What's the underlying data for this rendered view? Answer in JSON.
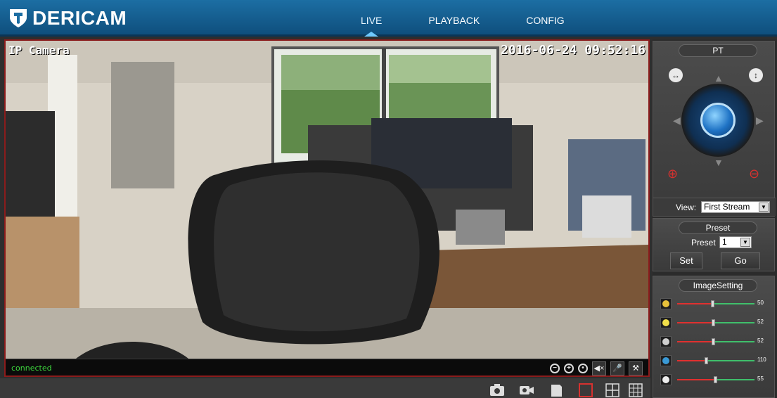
{
  "header": {
    "logo_text": "DERICAM",
    "nav": [
      {
        "label": "LIVE",
        "active": true
      },
      {
        "label": "PLAYBACK",
        "active": false
      },
      {
        "label": "CONFIG",
        "active": false
      }
    ]
  },
  "video": {
    "osd_name": "IP Camera",
    "osd_datetime": "2016-06-24 09:52:16",
    "status": "connected"
  },
  "ptz": {
    "title": "PT",
    "view_label": "View:",
    "view_value": "First Stream"
  },
  "preset": {
    "title": "Preset",
    "label": "Preset",
    "value": "1",
    "set_label": "Set",
    "go_label": "Go"
  },
  "image_setting": {
    "title": "ImageSetting",
    "sliders": [
      {
        "icon": "color-icon",
        "value": "50",
        "level": 0.45
      },
      {
        "icon": "brightness-icon",
        "value": "52",
        "level": 0.46
      },
      {
        "icon": "contrast-icon",
        "value": "52",
        "level": 0.46
      },
      {
        "icon": "saturation-icon",
        "value": "110",
        "level": 0.37
      },
      {
        "icon": "sharpness-icon",
        "value": "55",
        "level": 0.49
      }
    ]
  },
  "colors": {
    "header_bg": "#1c6ea3",
    "accent_red": "#d6312f",
    "status_green": "#3dd63d"
  }
}
